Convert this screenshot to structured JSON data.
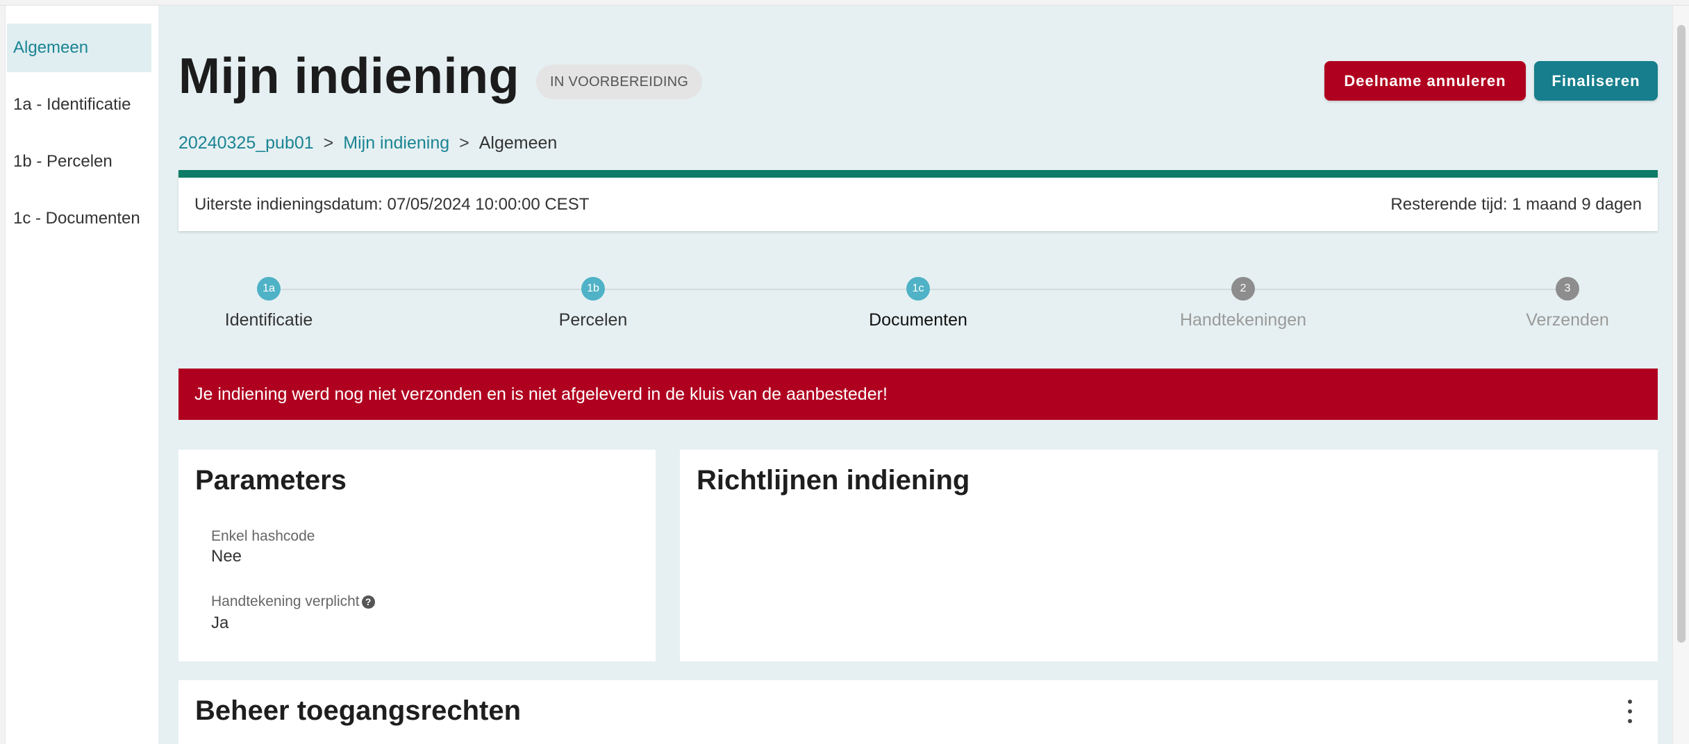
{
  "sidebar": {
    "items": [
      {
        "label": "Algemeen"
      },
      {
        "label": "1a - Identificatie"
      },
      {
        "label": "1b - Percelen"
      },
      {
        "label": "1c - Documenten"
      }
    ]
  },
  "header": {
    "title": "Mijn indiening",
    "status": "IN VOORBEREIDING",
    "cancel_label": "Deelname annuleren",
    "finalize_label": "Finaliseren"
  },
  "breadcrumb": {
    "items": [
      "20240325_pub01",
      "Mijn indiening",
      "Algemeen"
    ],
    "separator": ">"
  },
  "deadline": {
    "date_text": "Uiterste indieningsdatum: 07/05/2024 10:00:00 CEST",
    "remaining_text": "Resterende tijd: 1 maand 9 dagen"
  },
  "steps": [
    {
      "badge": "1a",
      "label": "Identificatie",
      "state": "done"
    },
    {
      "badge": "1b",
      "label": "Percelen",
      "state": "done"
    },
    {
      "badge": "1c",
      "label": "Documenten",
      "state": "current"
    },
    {
      "badge": "2",
      "label": "Handtekeningen",
      "state": "todo"
    },
    {
      "badge": "3",
      "label": "Verzenden",
      "state": "todo"
    }
  ],
  "alert": {
    "text": "Je indiening werd nog niet verzonden en is niet afgeleverd in de kluis van de aanbesteder!"
  },
  "parameters": {
    "title": "Parameters",
    "fields": [
      {
        "label": "Enkel hashcode",
        "value": "Nee"
      },
      {
        "label": "Handtekening verplicht",
        "value": "Ja"
      }
    ],
    "help_icon": "question-circle-icon"
  },
  "guidelines": {
    "title": "Richtlijnen indiening"
  },
  "access": {
    "title": "Beheer toegangsrechten",
    "menu_icon": "kebab-menu-icon"
  },
  "colors": {
    "primary": "#167e8c",
    "danger": "#b0001f",
    "progress": "#0e7c66",
    "background": "#e6f0f2"
  }
}
